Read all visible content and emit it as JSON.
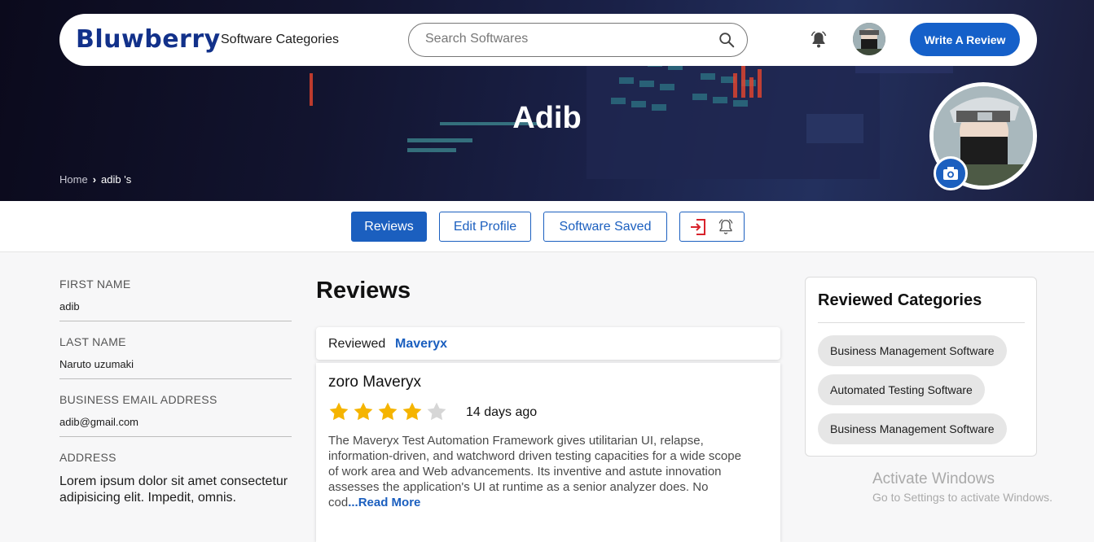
{
  "brand": {
    "logo": "Bluwberry",
    "accent": "#1b5fbf"
  },
  "nav": {
    "categories_label": "Software Categories",
    "search_placeholder": "Search Softwares",
    "write_review_label": "Write A Review",
    "icons": [
      "search-icon",
      "bell-icon",
      "avatar"
    ]
  },
  "hero": {
    "title": "Adib",
    "breadcrumb": {
      "home": "Home",
      "current": "adib 's"
    }
  },
  "tabs": [
    {
      "label": "Reviews",
      "active": true
    },
    {
      "label": "Edit Profile",
      "active": false
    },
    {
      "label": "Software Saved",
      "active": false
    }
  ],
  "tab_icons": [
    "logout-icon",
    "bell-outline-icon"
  ],
  "profile": {
    "first_name": {
      "label": "FIRST NAME",
      "value": "adib"
    },
    "last_name": {
      "label": "LAST NAME",
      "value": "Naruto uzumaki"
    },
    "email": {
      "label": "BUSINESS EMAIL ADDRESS",
      "value": "adib@gmail.com"
    },
    "address": {
      "label": "ADDRESS",
      "value": "Lorem ipsum dolor sit amet consectetur adipisicing elit. Impedit, omnis."
    }
  },
  "reviews": {
    "heading": "Reviews",
    "items": [
      {
        "reviewed_label": "Reviewed",
        "product": "Maveryx",
        "title": "zoro Maveryx",
        "rating": 4,
        "rating_max": 5,
        "time": "14 days ago",
        "body": "The Maveryx Test Automation Framework gives utilitarian UI, relapse, information-driven, and watchword driven testing capacities for a wide scope of work area and Web advancements. Its inventive and astute innovation assesses the application's UI at runtime as a senior analyzer does. No cod",
        "read_more": "...Read More"
      }
    ]
  },
  "reviewed_categories": {
    "heading": "Reviewed Categories",
    "items": [
      "Business Management Software",
      "Automated Testing Software",
      "Business Management Software"
    ]
  },
  "watermark": {
    "line1": "Activate Windows",
    "line2": "Go to Settings to activate Windows."
  },
  "colors": {
    "star_filled": "#f5b400",
    "star_empty": "#d6d6d6",
    "hero_bg": "#12142f"
  }
}
